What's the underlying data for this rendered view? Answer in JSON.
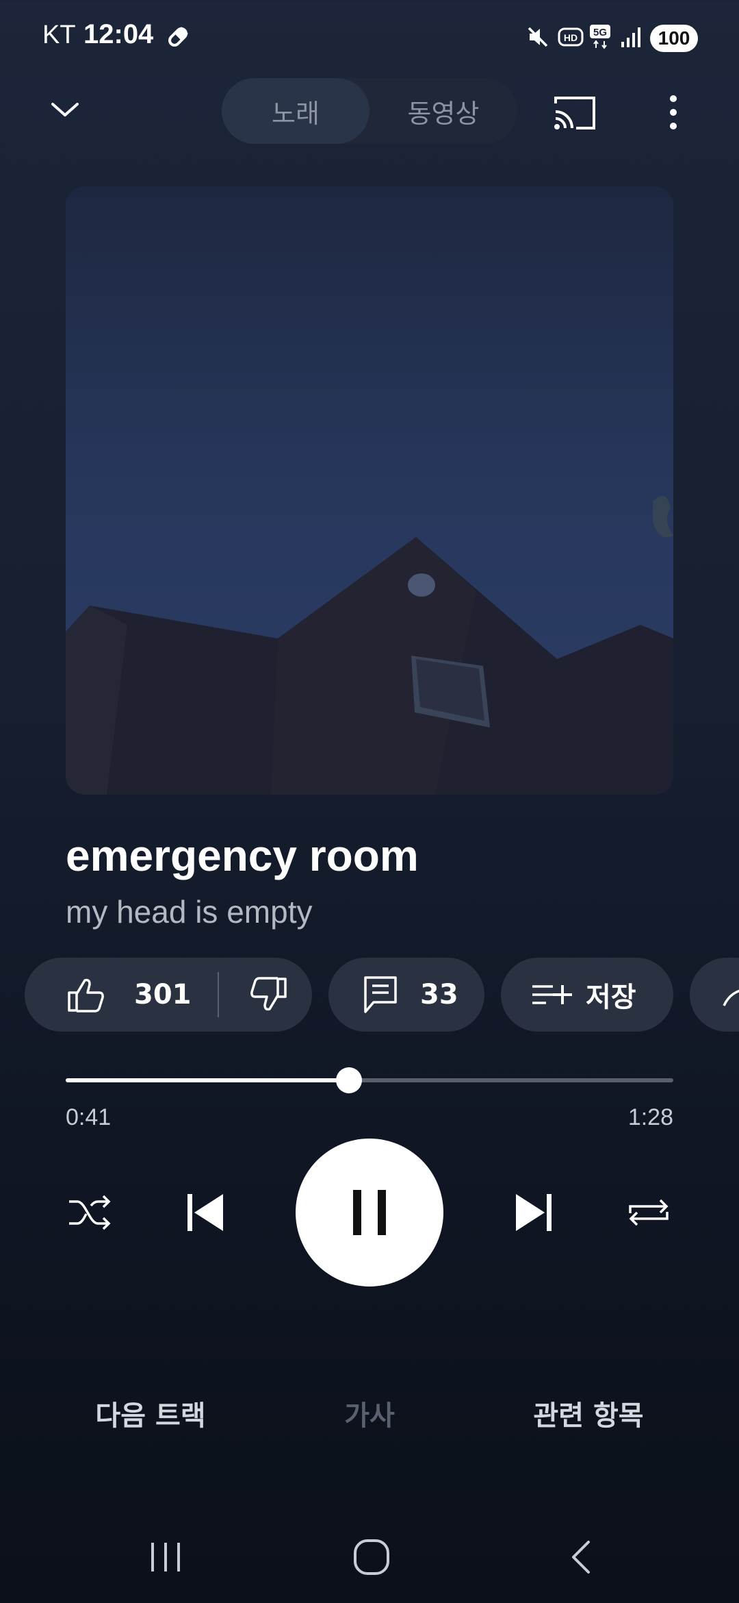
{
  "status_bar": {
    "carrier": "KT",
    "time": "12:04",
    "battery": "100",
    "icons": [
      "pill-icon",
      "mute-icon",
      "hd-icon",
      "5g-icon",
      "signal-icon",
      "battery-icon"
    ]
  },
  "top_bar": {
    "collapse_icon": "chevron-down-icon",
    "tabs": [
      {
        "label": "노래",
        "active": true
      },
      {
        "label": "동영상",
        "active": false
      }
    ],
    "cast_icon": "cast-icon",
    "menu_icon": "more-vert-icon"
  },
  "track": {
    "title": "emergency room",
    "artist": "my head is empty"
  },
  "actions": {
    "likes": "301",
    "comments": "33",
    "save_label": "저장"
  },
  "progress": {
    "current": "0:41",
    "duration": "1:28",
    "fraction": 0.466
  },
  "bottom_tabs": [
    {
      "label": "다음 트랙",
      "active": true
    },
    {
      "label": "가사",
      "active": false
    },
    {
      "label": "관련 항목",
      "active": true
    }
  ],
  "colors": {
    "background_top": "#1c2539",
    "background_bottom": "#0b1019",
    "chip": "#2a3140",
    "track_inactive": "#5a5f6b"
  }
}
